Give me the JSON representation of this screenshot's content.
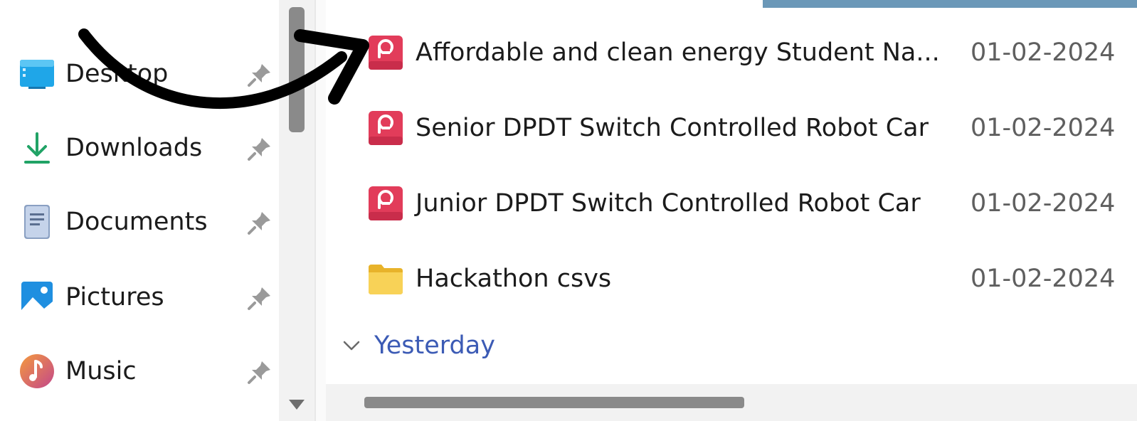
{
  "sidebar": {
    "items": [
      {
        "label": "Desktop",
        "icon": "desktop-icon"
      },
      {
        "label": "Downloads",
        "icon": "download-icon"
      },
      {
        "label": "Documents",
        "icon": "documents-icon"
      },
      {
        "label": "Pictures",
        "icon": "pictures-icon"
      },
      {
        "label": "Music",
        "icon": "music-icon"
      }
    ],
    "pin_icon": "pin-icon"
  },
  "files": {
    "rows": [
      {
        "name": "Affordable and clean energy  Student Na...",
        "date": "01-02-2024",
        "icon": "powerpoint-file-icon"
      },
      {
        "name": "Senior DPDT Switch Controlled Robot Car",
        "date": "01-02-2024",
        "icon": "powerpoint-file-icon"
      },
      {
        "name": "Junior DPDT Switch Controlled Robot Car",
        "date": "01-02-2024",
        "icon": "powerpoint-file-icon"
      },
      {
        "name": "Hackathon csvs",
        "date": "01-02-2024",
        "icon": "folder-icon"
      }
    ],
    "group_header": "Yesterday"
  },
  "colors": {
    "accent": "#3c5bb5",
    "ppt_red": "#e23c5a",
    "folder_yellow": "#f5c542",
    "scroll_thumb": "#8a8a8a"
  }
}
